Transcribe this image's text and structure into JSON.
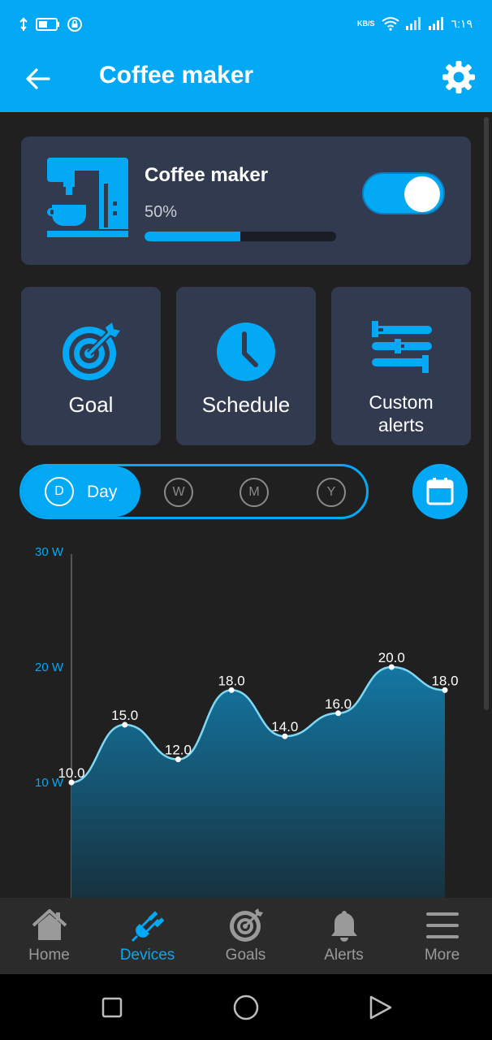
{
  "status_bar": {
    "network_speed": "KB/S",
    "time": "٦:١٩",
    "battery_icon": "battery-icon",
    "lock_icon": "lock-icon"
  },
  "app_bar": {
    "title": "Coffee maker",
    "back_icon": "arrow-left-icon",
    "settings_icon": "gear-icon"
  },
  "device": {
    "name": "Coffee maker",
    "percent_label": "50%",
    "progress": 0.5,
    "power_on": true,
    "icon": "coffee-machine-icon"
  },
  "tiles": [
    {
      "label": "Goal",
      "icon": "target-icon"
    },
    {
      "label": "Schedule",
      "icon": "clock-icon"
    },
    {
      "label_line1": "Custom",
      "label_line2": "alerts",
      "icon": "sliders-icon"
    }
  ],
  "range": {
    "options": [
      {
        "letter": "D",
        "label": "Day",
        "selected": true
      },
      {
        "letter": "W"
      },
      {
        "letter": "M"
      },
      {
        "letter": "Y"
      }
    ],
    "calendar_icon": "calendar-icon"
  },
  "chart_data": {
    "type": "area",
    "unit": "W",
    "y_ticks": [
      "10 W",
      "20 W",
      "30 W"
    ],
    "ylim": [
      0,
      32.5
    ],
    "values": [
      10.0,
      15.0,
      12.0,
      18.0,
      14.0,
      16.0,
      20.0,
      18.0
    ],
    "value_labels": [
      "10.0",
      "15.0",
      "12.0",
      "18.0",
      "14.0",
      "16.0",
      "20.0",
      "18.0"
    ],
    "colors": {
      "line": "#7fd9f5",
      "fill_top": "#1477a3",
      "fill_bottom": "#16323f",
      "tick": "#03A9F4"
    }
  },
  "bottom_nav": [
    {
      "label": "Home",
      "icon": "home-icon",
      "active": false
    },
    {
      "label": "Devices",
      "icon": "plug-icon",
      "active": true
    },
    {
      "label": "Goals",
      "icon": "target-icon",
      "active": false
    },
    {
      "label": "Alerts",
      "icon": "bell-icon",
      "active": false
    },
    {
      "label": "More",
      "icon": "menu-icon",
      "active": false
    }
  ],
  "system_nav": {
    "recents_icon": "square-icon",
    "home_icon": "circle-icon",
    "back_icon": "triangle-icon"
  },
  "colors": {
    "accent": "#03A9F4",
    "card": "#323A4F",
    "background": "#202020"
  }
}
